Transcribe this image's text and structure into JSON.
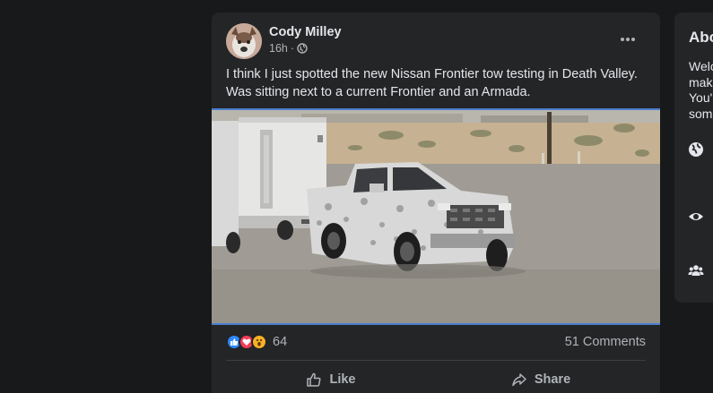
{
  "post": {
    "author": "Cody Milley",
    "time": "16h",
    "time_separator": "·",
    "privacy_icon": "globe-icon",
    "text": "I think I just spotted the new Nissan Frontier tow testing in Death Valley. Was sitting next to a current Frontier and an Armada.",
    "reactions": {
      "icons": [
        "like-icon",
        "love-icon",
        "wow-icon"
      ],
      "count": "64"
    },
    "comments": "51 Comments",
    "actions": {
      "like": "Like",
      "share": "Share"
    }
  },
  "sidebar": {
    "title": "Abo",
    "description_lines": [
      "Welc",
      "mak",
      "You'",
      "som"
    ],
    "icons": [
      "globe-icon",
      "eye-icon",
      "people-icon"
    ]
  },
  "colors": {
    "background": "#18191a",
    "card": "#242526",
    "text_primary": "#e4e6eb",
    "text_secondary": "#b0b3b8",
    "like_blue": "#2d88ff",
    "love_red": "#f33e58",
    "wow_yellow": "#f7b125"
  }
}
